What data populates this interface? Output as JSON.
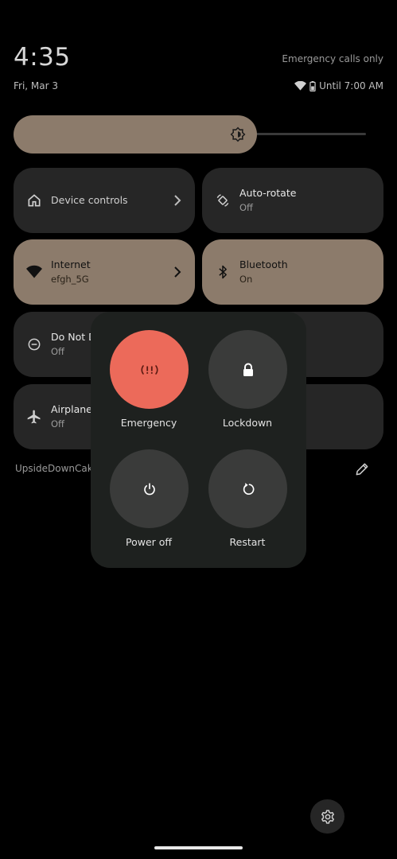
{
  "header": {
    "time": "4:35",
    "date": "Fri, Mar 3",
    "carrier_status": "Emergency calls only",
    "alarm": "Until 7:00 AM"
  },
  "brightness": {
    "level_percent": 60
  },
  "tiles": [
    {
      "id": "device-controls",
      "title": "Device controls",
      "subtitle": "",
      "active": false,
      "icon": "home-icon",
      "has_chevron": true
    },
    {
      "id": "auto-rotate",
      "title": "Auto-rotate",
      "subtitle": "Off",
      "active": false,
      "icon": "rotate-icon",
      "has_chevron": false
    },
    {
      "id": "internet",
      "title": "Internet",
      "subtitle": "efgh_5G",
      "active": true,
      "icon": "wifi-icon",
      "has_chevron": true
    },
    {
      "id": "bluetooth",
      "title": "Bluetooth",
      "subtitle": "On",
      "active": true,
      "icon": "bluetooth-icon",
      "has_chevron": false
    },
    {
      "id": "do-not-disturb",
      "title": "Do Not D",
      "subtitle": "Off",
      "active": false,
      "icon": "dnd-icon",
      "has_chevron": false
    },
    {
      "id": "airplane",
      "title": "Airplane",
      "subtitle": "Off",
      "active": false,
      "icon": "airplane-icon",
      "has_chevron": false
    }
  ],
  "footer": {
    "build_label": "UpsideDownCake"
  },
  "power_menu": {
    "emergency": "Emergency",
    "lockdown": "Lockdown",
    "power_off": "Power off",
    "restart": "Restart"
  },
  "colors": {
    "accent_tile": "#8c7b6b",
    "inactive_tile": "#262626",
    "emergency": "#ec6a5a",
    "panel": "#1e211f"
  }
}
